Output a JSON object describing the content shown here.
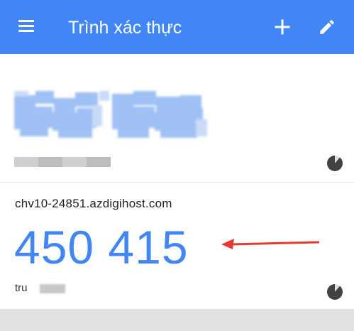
{
  "appbar": {
    "title": "Trình xác thực",
    "menu_icon": "menu-icon",
    "add_icon": "add-icon",
    "edit_icon": "edit-icon",
    "color": "#4285f4"
  },
  "accounts": [
    {
      "issuer": "",
      "code": "",
      "account": "",
      "code_obscured": true,
      "timer_icon": "countdown-timer-icon"
    },
    {
      "issuer": "chv10-24851.azdigihost.com",
      "code": "450 415",
      "account": "tru",
      "account_obscured_suffix": true,
      "timer_icon": "countdown-timer-icon"
    }
  ],
  "annotation": {
    "arrow_color": "#e53935"
  }
}
